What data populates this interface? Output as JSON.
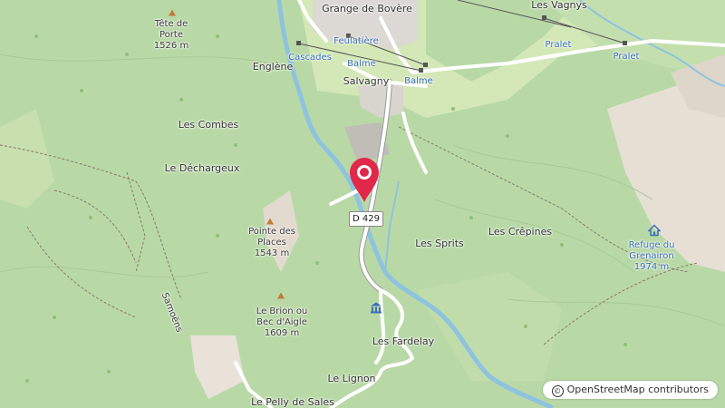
{
  "map": {
    "road_label": "D 429",
    "attribution": "OpenStreetMap contributors",
    "attribution_symbol": "©",
    "places": {
      "grange": "Grange de Bovère",
      "vagnys": "Les Vagnys",
      "feulatiere": "Feulatière",
      "balme1": "Balme",
      "balme2": "Balme",
      "pralet1": "Pralet",
      "pralet2": "Pralet",
      "cascades": "Cascades",
      "englene": "Englène",
      "salvagny": "Salvagny",
      "combes": "Les Combes",
      "dechargeux": "Le Déchargeux",
      "sprits": "Les Sprits",
      "crepines": "Les Crêpines",
      "refuge_name": "Refuge du Grenairon",
      "refuge_elev": "1974 m",
      "tete_name": "Tête de Porte",
      "tete_elev": "1526 m",
      "pointe_name": "Pointe des Places",
      "pointe_elev": "1543 m",
      "brion_name": "Le Brion ou Bec d'Aigle",
      "brion_elev": "1609 m",
      "samoens": "Samoëns",
      "fardelay": "Les Fardelay",
      "lignon": "Le Lignon",
      "pelly": "Le Pelly de Sales"
    },
    "icons": {
      "pin": "location-pin-icon",
      "refuge": "alpine-hut-icon",
      "museum": "museum-icon",
      "peaks": "peak-icon",
      "trees": "forest-tree-icon"
    },
    "colors": {
      "forest": "#b8d9a6",
      "meadow": "#d3e8b6",
      "rock": "#e8e0d6",
      "river": "#8ec3df",
      "road": "#ffffff",
      "pin": "#e0284b",
      "peak": "#c27a3c",
      "label_blue": "#3a6fb8"
    }
  }
}
